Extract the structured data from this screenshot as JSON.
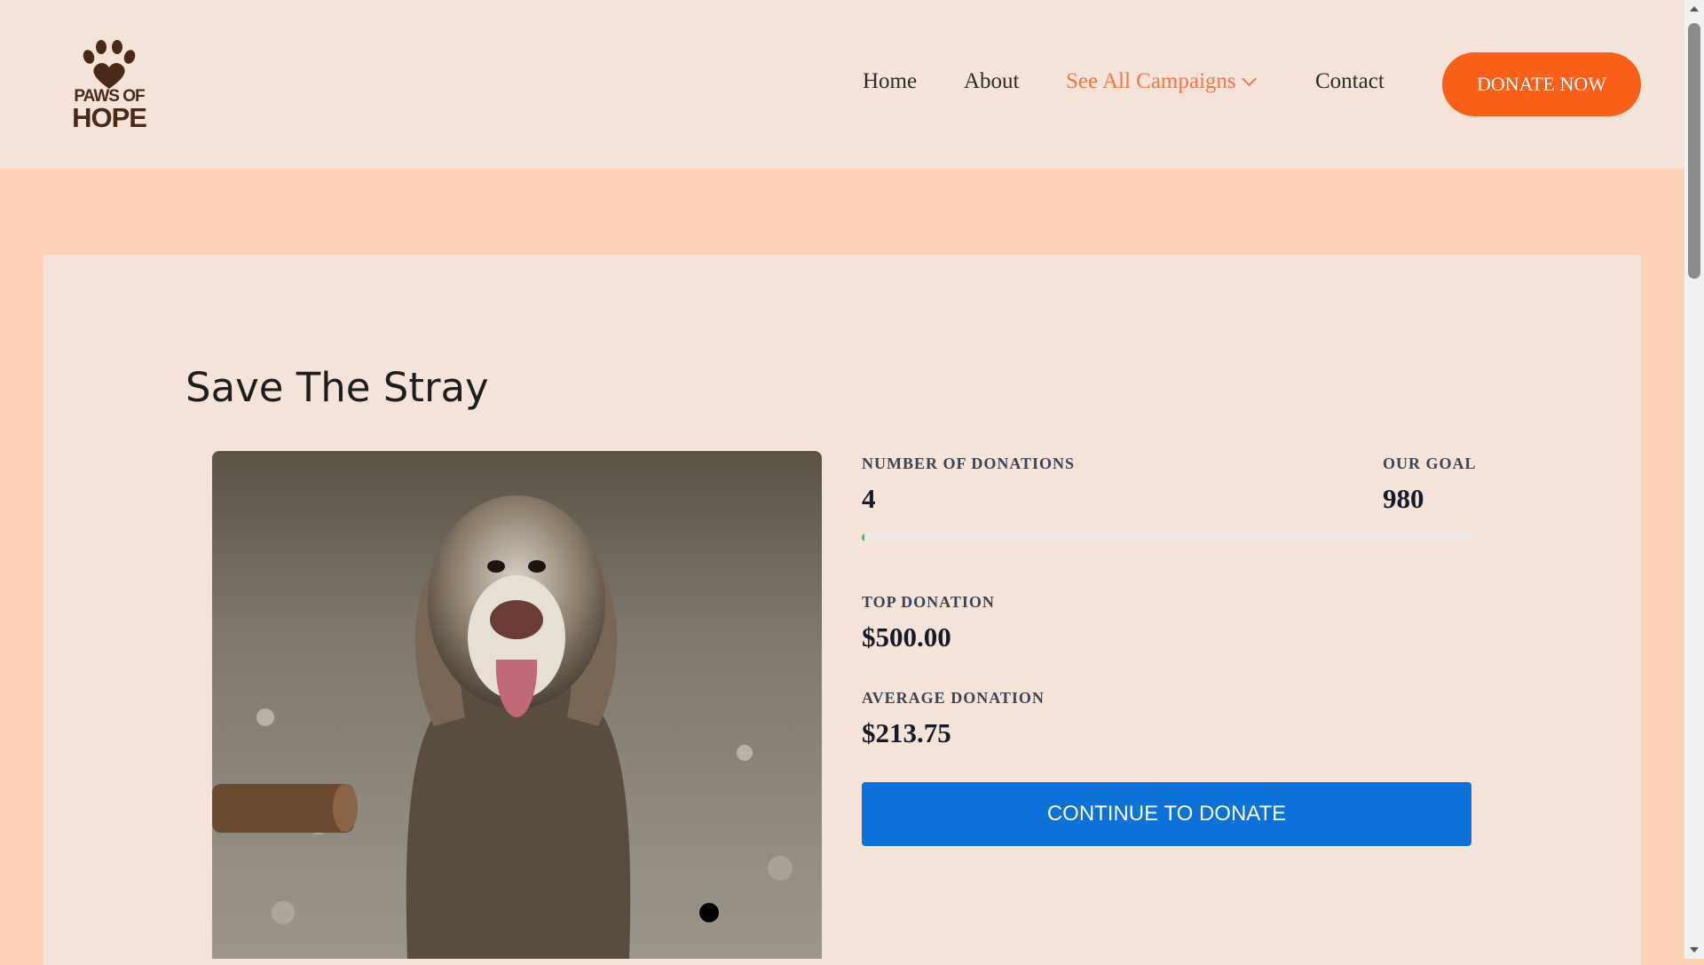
{
  "brand": {
    "line1": "PAWS OF",
    "line2": "HOPE"
  },
  "nav": {
    "home": "Home",
    "about": "About",
    "campaigns": "See All Campaigns",
    "contact": "Contact",
    "donate_now": "DONATE NOW"
  },
  "campaign": {
    "title": "Save The Stray",
    "num_donations_label": "NUMBER OF DONATIONS",
    "num_donations": "4",
    "goal_label": "OUR GOAL",
    "goal": "980",
    "progress_fraction": 0.004,
    "top_donation_label": "TOP DONATION",
    "top_donation": "$500.00",
    "avg_donation_label": "AVERAGE DONATION",
    "avg_donation": "$213.75",
    "continue_label": "CONTINUE TO DONATE"
  },
  "icons": {
    "logo": "paw-heart-icon",
    "dropdown": "chevron-down-icon"
  },
  "colors": {
    "page_bg": "#fdd3b5",
    "header_bg": "#f5e3d9",
    "accent_orange": "#fa5f1a",
    "nav_active": "#f1784a",
    "cta_blue": "#0c72d9",
    "progress_green": "#3bbf4f"
  }
}
